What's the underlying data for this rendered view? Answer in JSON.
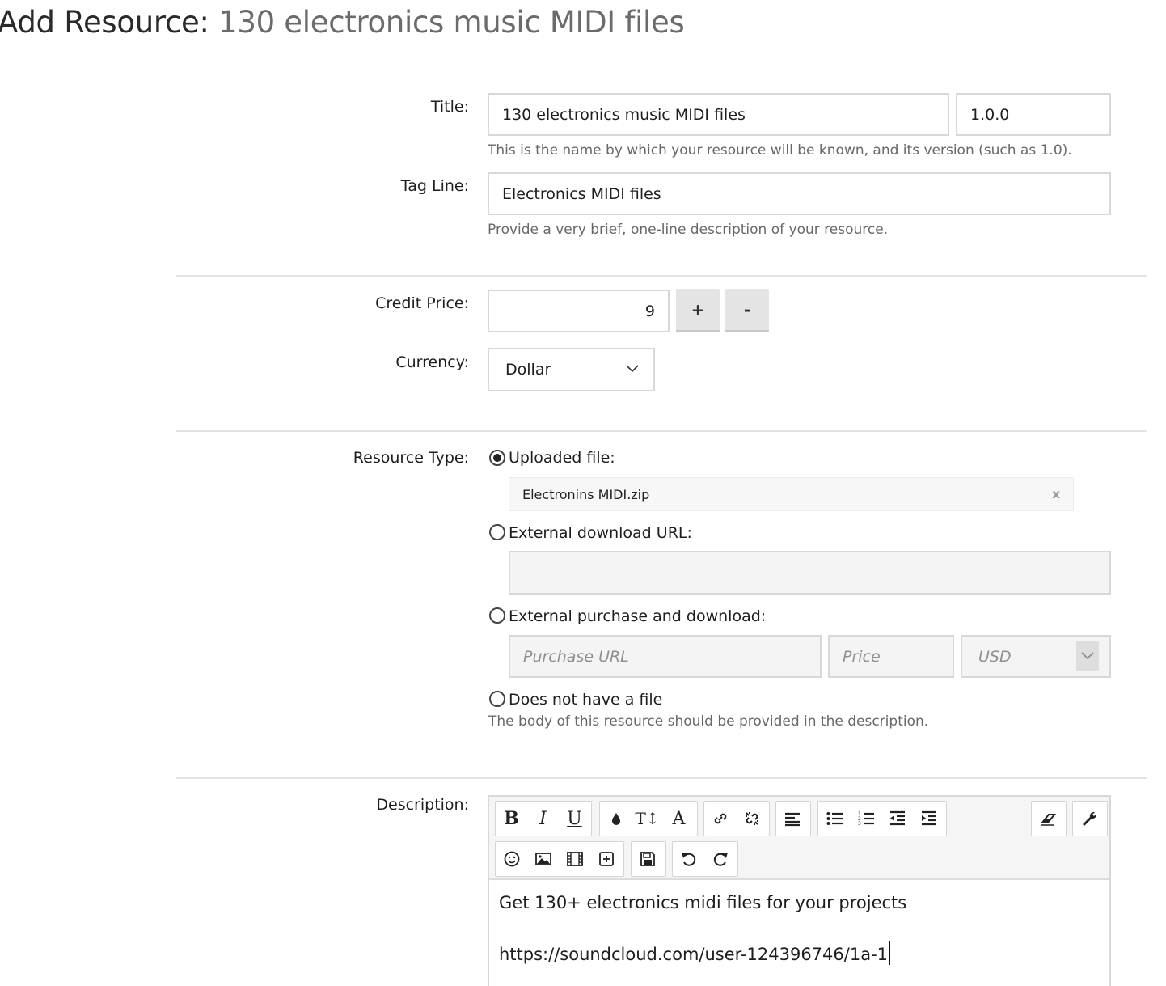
{
  "page": {
    "title_prefix": "Add Resource:",
    "title_name": "130 electronics music MIDI files"
  },
  "form": {
    "title": {
      "label": "Title:",
      "value": "130 electronics music MIDI files",
      "version": "1.0.0",
      "hint": "This is the name by which your resource will be known, and its version (such as 1.0)."
    },
    "tagline": {
      "label": "Tag Line:",
      "value": "Electronics MIDI files",
      "hint": "Provide a very brief, one-line description of your resource."
    },
    "credit_price": {
      "label": "Credit Price:",
      "value": "9",
      "plus": "+",
      "minus": "-"
    },
    "currency": {
      "label": "Currency:",
      "selected": "Dollar"
    },
    "resource_type": {
      "label": "Resource Type:",
      "options": [
        {
          "label": "Uploaded file:",
          "checked": true
        },
        {
          "label": "External download URL:",
          "checked": false
        },
        {
          "label": "External purchase and download:",
          "checked": false
        },
        {
          "label": "Does not have a file",
          "checked": false
        }
      ],
      "uploaded_file_name": "Electronins MIDI.zip",
      "remove_symbol": "x",
      "purchase_url_placeholder": "Purchase URL",
      "price_placeholder": "Price",
      "purchase_currency": "USD",
      "no_file_hint": "The body of this resource should be provided in the description."
    },
    "description": {
      "label": "Description:",
      "toolbar_row1": [
        "bold-icon",
        "italic-icon",
        "underline-icon",
        "text-color-icon",
        "font-size-icon",
        "font-family-icon",
        "link-icon",
        "unlink-icon",
        "align-left-icon",
        "bulleted-list-icon",
        "numbered-list-icon",
        "outdent-icon",
        "indent-icon",
        "remove-format-icon",
        "toggle-bbcode-icon"
      ],
      "toolbar_row2": [
        "smilie-icon",
        "image-icon",
        "media-icon",
        "insert-icon",
        "save-draft-icon",
        "undo-icon",
        "redo-icon"
      ],
      "bold_glyph": "B",
      "italic_glyph": "I",
      "underline_glyph": "U",
      "font_size_glyph": "T↕",
      "font_family_glyph": "A",
      "body_line1": "Get 130+ electronics midi files for your projects",
      "body_line2": "https://soundcloud.com/user-124396746/1a-1"
    }
  }
}
